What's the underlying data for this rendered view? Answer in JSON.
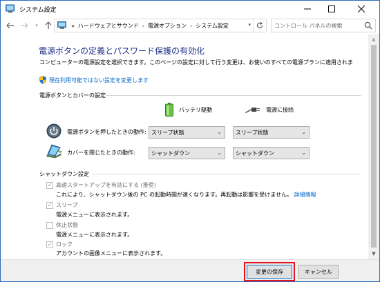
{
  "window": {
    "title": "システム設定"
  },
  "nav": {
    "breadcrumb_prefix": "«",
    "breadcrumb": [
      "ハードウェアとサウンド",
      "電源オプション",
      "システム設定"
    ],
    "search_placeholder": "コントロール パネルの検索"
  },
  "page": {
    "title": "電源ボタンの定義とパスワード保護の有効化",
    "description": "コンピューターの電源設定を選択できます。このページの設定に対して行う変更は、お使いのすべての電源プランに適用されま",
    "admin_link": "現在利用可能ではない設定を変更します"
  },
  "power_section": {
    "label": "電源ボタンとカバーの設定",
    "battery_label": "バッテリ駆動",
    "ac_label": "電源に接続",
    "rows": [
      {
        "label": "電源ボタンを押したときの動作:",
        "battery": "スリープ状態",
        "ac": "スリープ状態"
      },
      {
        "label": "カバーを閉じたときの動作:",
        "battery": "シャットダウン",
        "ac": "シャットダウン"
      }
    ]
  },
  "shutdown_section": {
    "label": "シャットダウン設定",
    "items": [
      {
        "label": "高速スタートアップを有効にする (推奨)",
        "checked": true,
        "desc": "これにより、シャットダウン後の PC の起動時間が速くなります。再起動は影響を受けません。",
        "link": "詳細情報"
      },
      {
        "label": "スリープ",
        "checked": true,
        "desc": "電源メニューに表示されます。"
      },
      {
        "label": "休止状態",
        "checked": false,
        "desc": "電源メニューに表示されます。"
      },
      {
        "label": "ロック",
        "checked": true,
        "desc": "アカウントの画像メニューに表示されます。"
      }
    ]
  },
  "footer": {
    "save_label": "変更の保存",
    "cancel_label": "キャンセル"
  },
  "colors": {
    "title": "#1e3287",
    "link": "#0066cc",
    "highlight": "#e3141b"
  }
}
